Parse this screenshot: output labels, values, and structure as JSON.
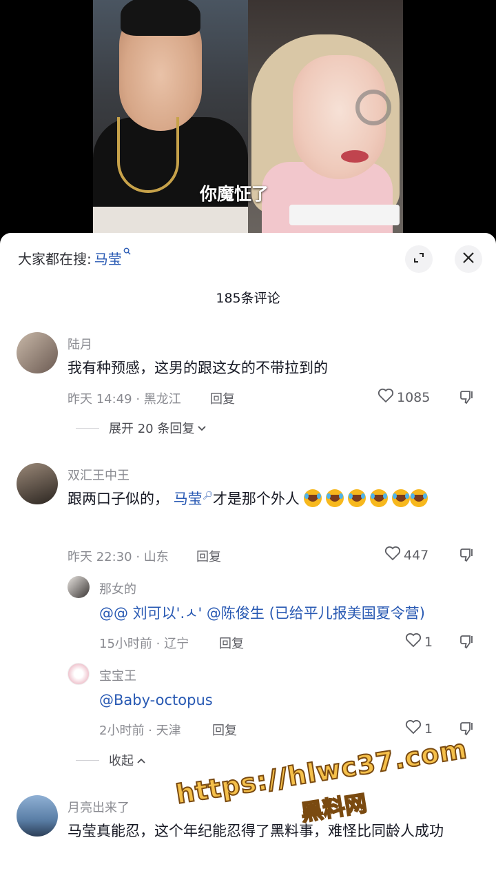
{
  "video": {
    "subtitle": "你魔怔了"
  },
  "sheet": {
    "search_prefix": "大家都在搜: ",
    "search_keyword": "马莹",
    "comment_count": "185条评论"
  },
  "comments": [
    {
      "user": "陆月",
      "text": "我有种预感，这男的跟这女的不带拉到的",
      "meta": "昨天 14:49 · 黑龙江",
      "reply_label": "回复",
      "likes": "1085",
      "expand_label": "展开 20 条回复"
    },
    {
      "user": "双汇王中王",
      "text_before": "跟两口子似的，",
      "mention": "马莹",
      "text_after": "才是那个外人",
      "meta": "昨天 22:30 · 山东",
      "reply_label": "回复",
      "likes": "447",
      "replies": [
        {
          "user": "那女的",
          "text": "@@ 刘可以'.ㅅ' @陈俊生 (已给平儿报美国夏令营)",
          "meta": "15小时前 · 辽宁",
          "reply_label": "回复",
          "likes": "1"
        },
        {
          "user": "宝宝王",
          "text": "@Baby-octopus",
          "meta": "2小时前 · 天津",
          "reply_label": "回复",
          "likes": "1"
        }
      ],
      "collapse_label": "收起"
    },
    {
      "user": "月亮出来了",
      "text": "马莹真能忍，这个年纪能忍得了黑料事，难怪比同龄人成功"
    }
  ],
  "watermark": {
    "url": "https://hlwc37.com",
    "brand": "黑料网"
  },
  "colors": {
    "link": "#2859b3",
    "muted": "#8a8b91",
    "watermark": "#f5c04a"
  }
}
